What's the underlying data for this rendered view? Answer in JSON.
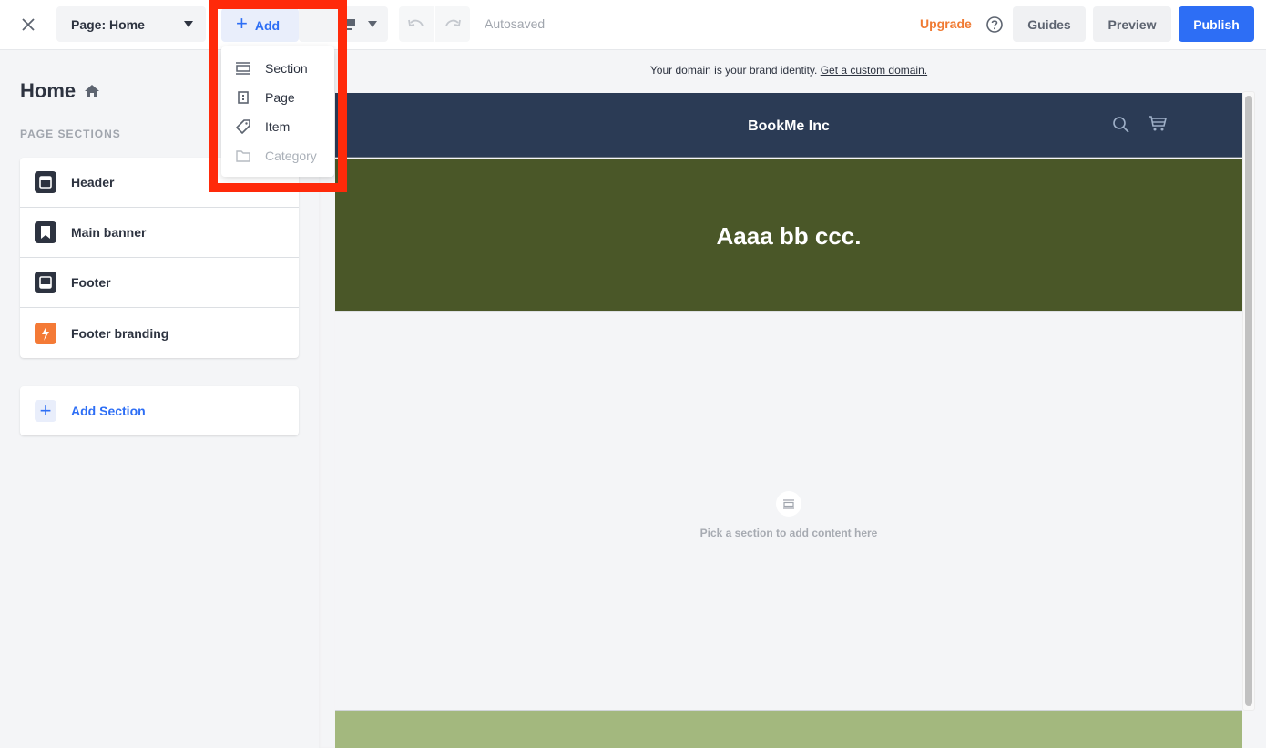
{
  "topbar": {
    "close_icon": "close-icon",
    "page_select_label": "Page: Home",
    "add_label": "Add",
    "device_icon": "desktop-icon",
    "undo_icon": "undo-icon",
    "redo_icon": "redo-icon",
    "status": "Autosaved",
    "upgrade_label": "Upgrade",
    "help_icon": "help-icon",
    "guides_label": "Guides",
    "preview_label": "Preview",
    "publish_label": "Publish"
  },
  "add_menu": {
    "items": [
      {
        "label": "Section",
        "icon": "section-icon",
        "disabled": false
      },
      {
        "label": "Page",
        "icon": "page-icon",
        "disabled": false
      },
      {
        "label": "Item",
        "icon": "tag-icon",
        "disabled": false
      },
      {
        "label": "Category",
        "icon": "folder-icon",
        "disabled": true
      }
    ]
  },
  "sidebar": {
    "title": "Home",
    "title_icon": "home-icon",
    "sections_heading": "PAGE SECTIONS",
    "sections": [
      {
        "label": "Header",
        "icon": "header-section-icon"
      },
      {
        "label": "Main banner",
        "icon": "bookmark-icon"
      },
      {
        "label": "Footer",
        "icon": "footer-section-icon"
      },
      {
        "label": "Footer branding",
        "icon": "lightning-icon"
      }
    ],
    "add_section_label": "Add Section"
  },
  "domain_banner": {
    "text": "Your domain is your brand identity.",
    "link_label": "Get a custom domain."
  },
  "canvas": {
    "site_name": "BookMe Inc",
    "banner_heading": "Aaaa bb ccc.",
    "empty_message": "Pick a section to add content here"
  },
  "colors": {
    "accent": "#2d6ef5",
    "upgrade": "#f07a32",
    "highlight": "#ff2a0a",
    "site_header_bg": "#2b3b55",
    "banner_bg": "#4a5728",
    "footer_bg": "#a3b87e"
  }
}
